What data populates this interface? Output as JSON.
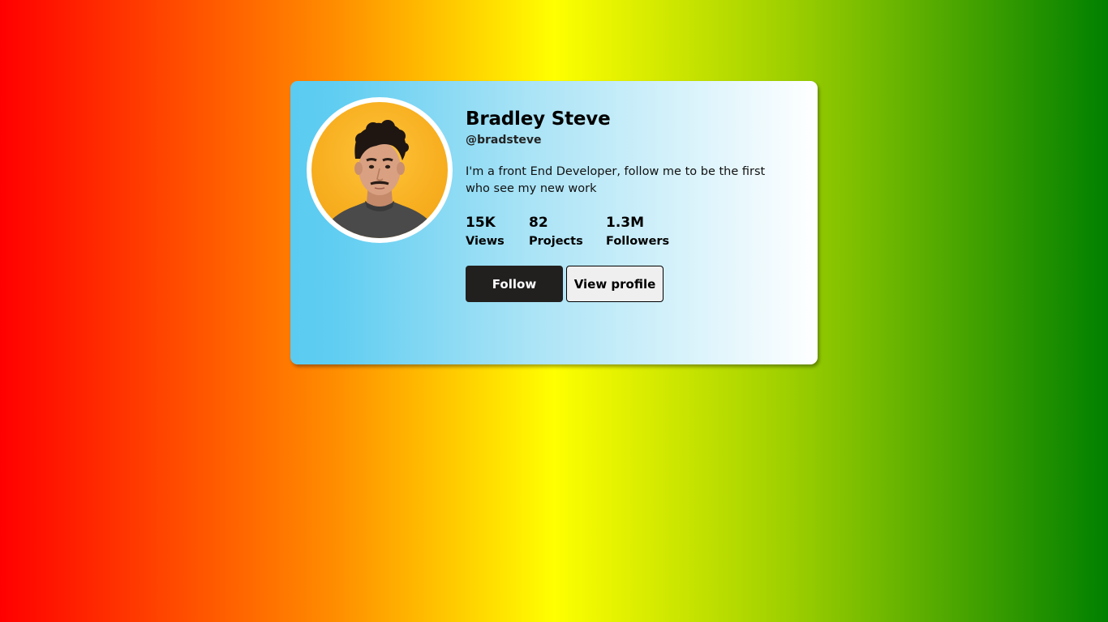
{
  "profile": {
    "name": "Bradley Steve",
    "handle": "@bradsteve",
    "bio": "I'm a front End Developer, follow me to be the first who see my new work",
    "avatar_alt": "profile-photo"
  },
  "stats": [
    {
      "value": "15K",
      "label": "Views"
    },
    {
      "value": "82",
      "label": "Projects"
    },
    {
      "value": "1.3M",
      "label": "Followers"
    }
  ],
  "actions": {
    "follow_label": "Follow",
    "view_profile_label": "View profile"
  },
  "colors": {
    "background_gradient": [
      "#ff0000",
      "#ff8c00",
      "#ffff00",
      "#9acd00",
      "#008000"
    ],
    "card_gradient": [
      "#5bcbf1",
      "#ffffff"
    ],
    "follow_button_bg": "#221f1f",
    "view_button_bg": "#efefef",
    "avatar_bg": "#f7ae1f"
  }
}
